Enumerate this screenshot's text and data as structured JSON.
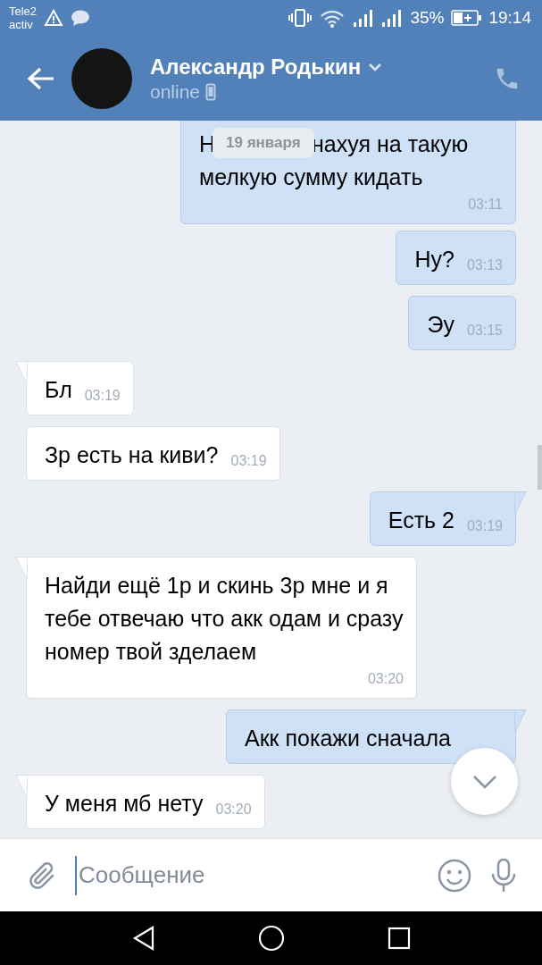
{
  "status_bar": {
    "carrier_line1": "Tele2",
    "carrier_line2": "activ",
    "battery": "35%",
    "time": "19:14"
  },
  "header": {
    "name": "Александр Родькин",
    "status": "online"
  },
  "date_badge": "19 января",
  "messages": [
    {
      "kind": "outgoing",
      "tail": false,
      "covered_start": "Н",
      "text": "нахуя на такую",
      "continuation": "мелкую сумму кидать",
      "time": "03:11"
    },
    {
      "kind": "outgoing",
      "tail": false,
      "text": "Ну?",
      "time": "03:13"
    },
    {
      "kind": "outgoing",
      "tail": false,
      "text": "Эу",
      "time": "03:15"
    },
    {
      "kind": "incoming",
      "tail": true,
      "text": "Бл",
      "time": "03:19"
    },
    {
      "kind": "incoming",
      "tail": false,
      "text": "Зр есть на киви?",
      "time": "03:19"
    },
    {
      "kind": "outgoing",
      "tail": true,
      "text": "Есть 2",
      "time": "03:19"
    },
    {
      "kind": "incoming",
      "tail": true,
      "text": "Найди ещё 1р и скинь 3р мне и я тебе отвечаю что акк одам и сразу номер твой зделаем",
      "time": "03:20"
    },
    {
      "kind": "outgoing",
      "tail": true,
      "text": "Акк покажи сначала"
    },
    {
      "kind": "incoming",
      "tail": true,
      "text": "У меня мб нету",
      "time": "03:20"
    }
  ],
  "composer": {
    "placeholder": "Сообщение"
  }
}
